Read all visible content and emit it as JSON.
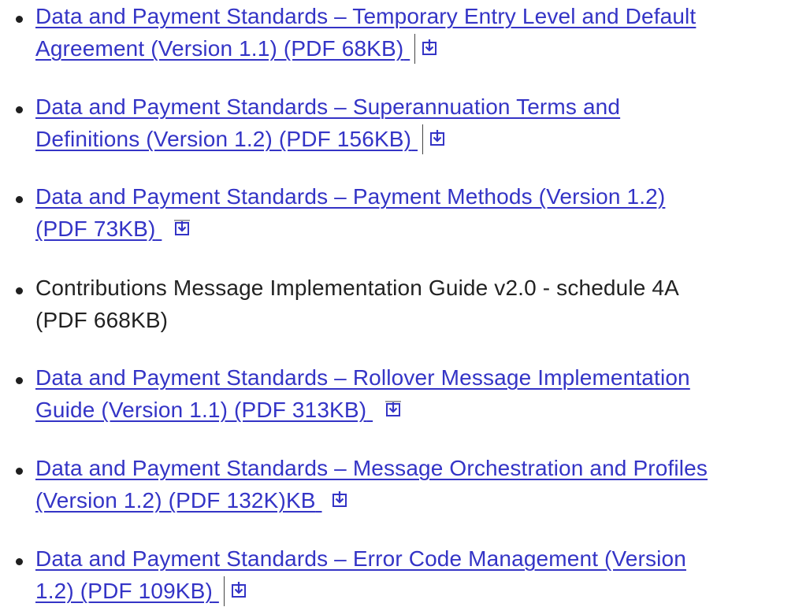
{
  "items": [
    {
      "line1": "Data and Payment Standards – Temporary Entry Level and Default",
      "line2": "Agreement (Version 1.1) (PDF 68KB)",
      "is_link": true,
      "icon": "download-icon"
    },
    {
      "line1": "Data and Payment Standards – Superannuation Terms and",
      "line2": "Definitions (Version 1.2) (PDF 156KB)",
      "is_link": true,
      "icon": "download-icon"
    },
    {
      "line1": "Data and Payment Standards – Payment Methods (Version 1.2)",
      "line2": "(PDF 73KB)",
      "is_link": true,
      "icon": "download-icon"
    },
    {
      "line1": "Contributions Message Implementation Guide v2.0 - schedule 4A",
      "line2": "(PDF 668KB)",
      "is_link": false,
      "icon": ""
    },
    {
      "line1": "Data and Payment Standards – Rollover Message Implementation",
      "line2": "Guide (Version 1.1) (PDF 313KB)",
      "is_link": true,
      "icon": "download-icon"
    },
    {
      "line1": "Data and Payment Standards – Message Orchestration and Profiles",
      "line2": "(Version 1.2) (PDF 132K)KB",
      "is_link": true,
      "icon": "download-icon"
    },
    {
      "line1": "Data and Payment Standards – Error Code Management (Version",
      "line2": "1.2) (PDF 109KB)",
      "is_link": true,
      "icon": "download-icon"
    }
  ],
  "colors": {
    "link": "#3434c6",
    "text": "#222222",
    "bullet": "#1f1f1f"
  }
}
